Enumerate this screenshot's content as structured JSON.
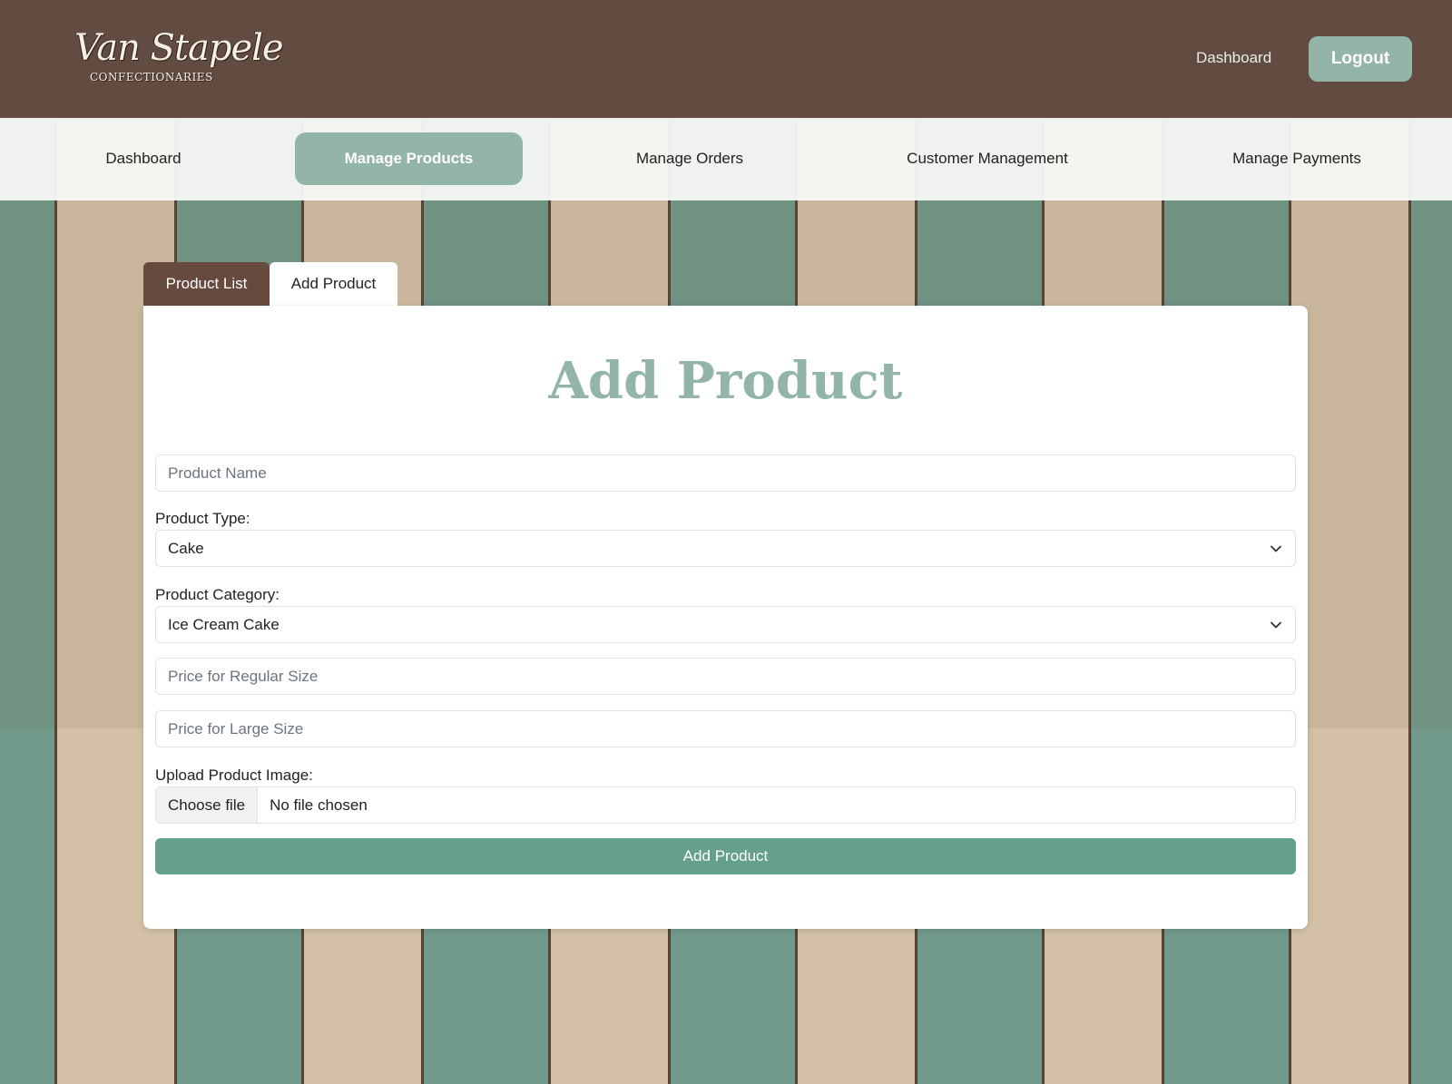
{
  "header": {
    "logo_title": "Van Stapele",
    "logo_subtitle": "CONFECTIONARIES",
    "dashboard_link": "Dashboard",
    "logout_label": "Logout"
  },
  "nav": {
    "items": [
      {
        "label": "Dashboard"
      },
      {
        "label": "Manage Products",
        "active": true
      },
      {
        "label": "Manage Orders"
      },
      {
        "label": "Customer Management"
      },
      {
        "label": "Manage Payments"
      }
    ]
  },
  "tabs": {
    "product_list": "Product List",
    "add_product": "Add Product"
  },
  "form": {
    "title": "Add Product",
    "product_name_placeholder": "Product Name",
    "product_type_label": "Product Type:",
    "product_type_value": "Cake",
    "product_category_label": "Product Category:",
    "product_category_value": "Ice Cream Cake",
    "price_regular_placeholder": "Price for Regular Size",
    "price_large_placeholder": "Price for Large Size",
    "upload_label": "Upload Product Image:",
    "choose_file_label": "Choose file",
    "no_file_text": "No file chosen",
    "submit_label": "Add Product"
  },
  "colors": {
    "header_bg": "#624c41",
    "accent_sage": "#93b5a8",
    "submit_green": "#65a08b",
    "tab_brown": "#664a3e"
  }
}
